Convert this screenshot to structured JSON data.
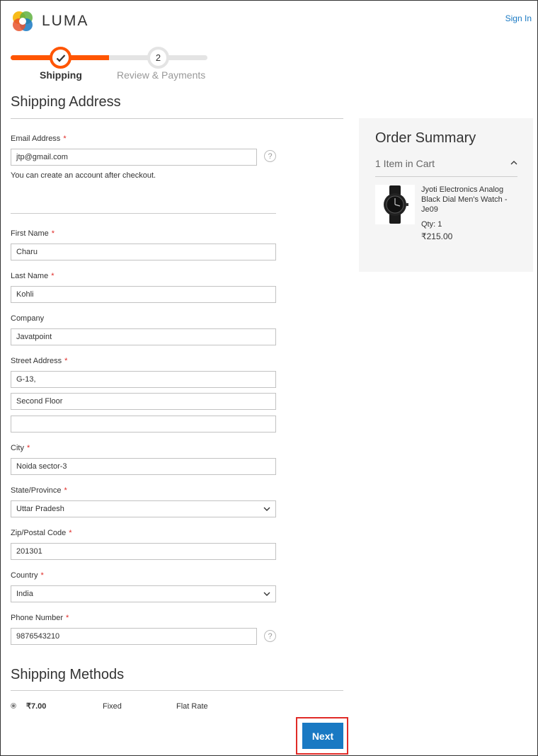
{
  "header": {
    "brand": "LUMA",
    "sign_in": "Sign In"
  },
  "progress": {
    "step1_label": "Shipping",
    "step2_number": "2",
    "step2_label": "Review & Payments"
  },
  "shipping_address": {
    "title": "Shipping Address",
    "email": {
      "label": "Email Address",
      "required": "*",
      "value": "jtp@gmail.com",
      "help": "?"
    },
    "account_note": "You can create an account after checkout.",
    "first_name": {
      "label": "First Name",
      "required": "*",
      "value": "Charu"
    },
    "last_name": {
      "label": "Last Name",
      "required": "*",
      "value": "Kohli"
    },
    "company": {
      "label": "Company",
      "value": "Javatpoint"
    },
    "street": {
      "label": "Street Address",
      "required": "*",
      "line1": "G-13,",
      "line2": "Second Floor",
      "line3": ""
    },
    "city": {
      "label": "City",
      "required": "*",
      "value": "Noida sector-3"
    },
    "state": {
      "label": "State/Province",
      "required": "*",
      "value": "Uttar Pradesh"
    },
    "zip": {
      "label": "Zip/Postal Code",
      "required": "*",
      "value": "201301"
    },
    "country": {
      "label": "Country",
      "required": "*",
      "value": "India"
    },
    "phone": {
      "label": "Phone Number",
      "required": "*",
      "value": "9876543210",
      "help": "?"
    }
  },
  "shipping_methods": {
    "title": "Shipping Methods",
    "method": {
      "price": "₹7.00",
      "type": "Fixed",
      "carrier": "Flat Rate"
    },
    "next_label": "Next"
  },
  "order_summary": {
    "title": "Order Summary",
    "items_in_cart": "1 Item in Cart",
    "product": {
      "name": "Jyoti Electronics Analog Black Dial Men's Watch - Je09",
      "qty": "Qty: 1",
      "price": "₹215.00"
    }
  },
  "colors": {
    "accent_orange": "#ff5501",
    "link_blue": "#1979c3",
    "required_red": "#e02b27"
  }
}
